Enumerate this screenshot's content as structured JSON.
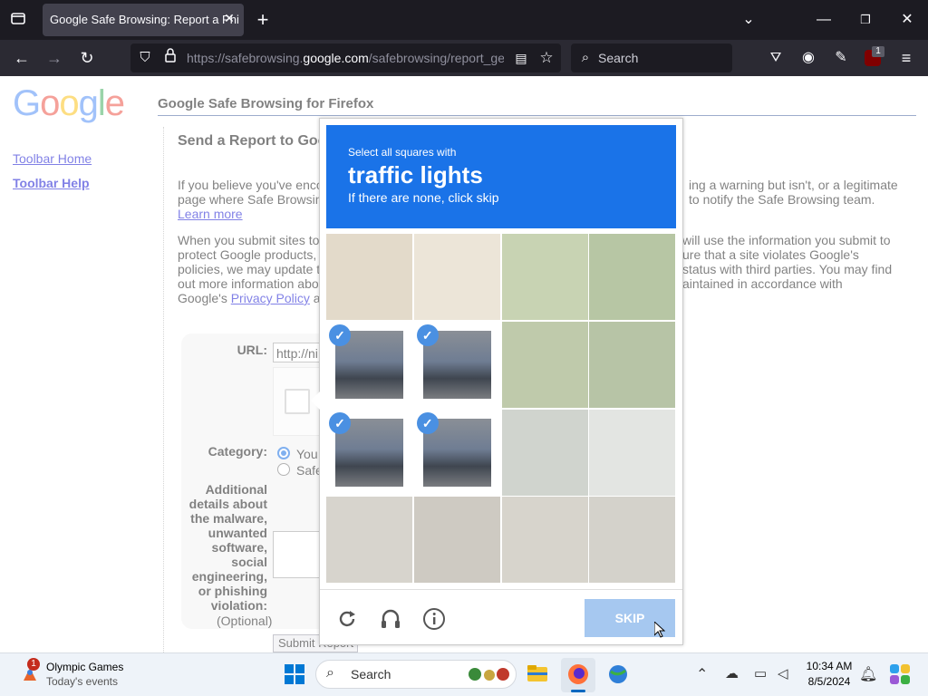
{
  "browser": {
    "tab_title": "Google Safe Browsing: Report a Phi",
    "url_prefix": "https://safebrowsing.",
    "url_domain": "google.com",
    "url_suffix": "/safebrowsing/report_ge",
    "search_placeholder": "Search",
    "extension_badge": "1"
  },
  "page": {
    "logo_text": "Google",
    "header": "Google Safe Browsing for Firefox",
    "sidebar": [
      "Toolbar Home",
      "Toolbar Help"
    ],
    "title": "Send a Report to Goo",
    "para1_line1": "If you believe you've encour",
    "para1_line1_right": "ing a warning but isn't, or a legitimate",
    "para1_line2": "page where Safe Browsing",
    "para1_line2_right": "to notify the Safe Browsing team.",
    "learn_more": "Learn more",
    "para2_line1": "When you submit sites to u",
    "para2_line1_right": "will use the information you submit to",
    "para2_line2": "protect Google products, in",
    "para2_line2_right": "ure that a site violates Google's",
    "para2_line3": "policies, we may update th",
    "para2_line3_right": "status with third parties. You may find",
    "para2_line4": "out more information about",
    "para2_line4_right": "aintained in accordance with",
    "para2_line5_prefix": "Google's ",
    "privacy_policy": "Privacy Policy",
    "para2_line5_suffix": " an",
    "url_label": "URL:",
    "url_value": "http://ni",
    "category_label": "Category:",
    "category_options": [
      "You",
      "Safe"
    ],
    "details_label": "Additional details about the malware, unwanted software, social engineering, or phishing violation:",
    "optional": "(Optional)",
    "submit": "Submit Report"
  },
  "captcha": {
    "instruction": "Select all squares with",
    "target": "traffic lights",
    "hint": "If there are none, click skip",
    "skip": "SKIP",
    "selected_cells": [
      4,
      5,
      8,
      9
    ]
  },
  "taskbar": {
    "weather_title": "Olympic Games",
    "weather_sub": "Today's events",
    "weather_badge": "1",
    "search": "Search",
    "time": "10:34 AM",
    "date": "8/5/2024"
  },
  "colors": {
    "captcha_blue": "#1a73e8",
    "check_blue": "#4a90e2",
    "skip_disabled": "#a6c8f0",
    "browser_dark": "#2b2a33"
  }
}
